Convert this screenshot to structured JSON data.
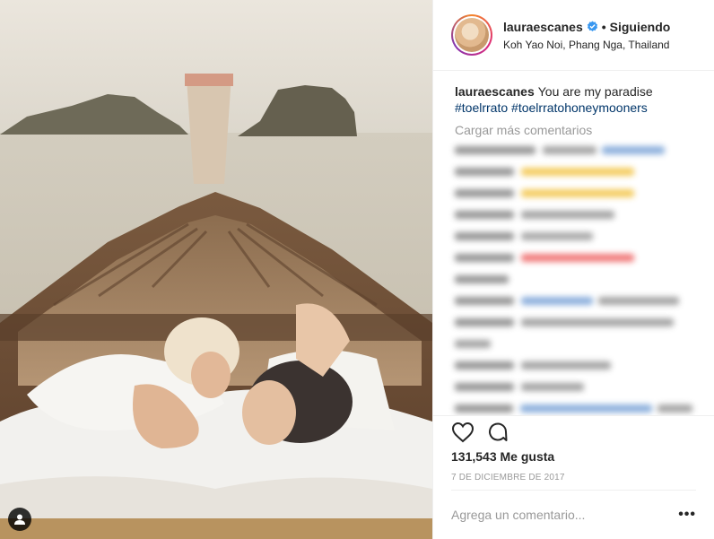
{
  "post": {
    "header": {
      "username": "lauraescanes",
      "separator": "•",
      "follow_status": "Siguiendo",
      "location": "Koh Yao Noi, Phang Nga, Thailand",
      "avatar_icon": "profile-avatar",
      "verified_icon": "verified-badge-icon"
    },
    "caption": {
      "username": "lauraescanes",
      "text": "You are my paradise",
      "hashtag1": "#toelrrato",
      "hashtag2": "#toelrratohoneymooners"
    },
    "load_more_label": "Cargar más comentarios",
    "likes": "131,543 Me gusta",
    "date": "7 DE DICIEMBRE DE 2017",
    "comment_placeholder": "Agrega un comentario...",
    "more_options": "•••",
    "icons": {
      "like": "heart-icon",
      "comment": "speech-bubble-icon",
      "tagged_user": "user-tag-icon"
    },
    "colors": {
      "username": "#262626",
      "hashtag": "#003569",
      "muted": "#999999",
      "verified": "#3897f0"
    }
  }
}
